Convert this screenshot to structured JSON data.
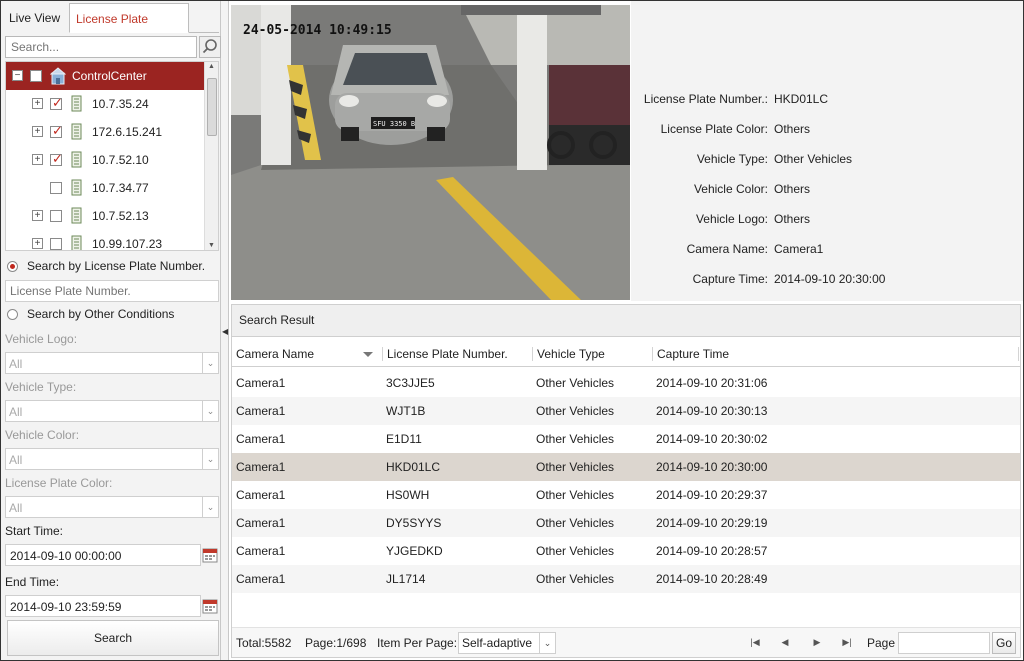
{
  "tabs": [
    {
      "label": "Live View"
    },
    {
      "label": "License Plate Query"
    }
  ],
  "search": {
    "placeholder": "Search..."
  },
  "tree": {
    "root": {
      "label": "ControlCenter"
    },
    "items": [
      {
        "label": "10.7.35.24",
        "checked": true,
        "expandable": true
      },
      {
        "label": "172.6.15.241",
        "checked": true,
        "expandable": true
      },
      {
        "label": "10.7.52.10",
        "checked": true,
        "expandable": true
      },
      {
        "label": "10.7.34.77",
        "checked": false,
        "expandable": false
      },
      {
        "label": "10.7.52.13",
        "checked": false,
        "expandable": true
      },
      {
        "label": "10.99.107.23",
        "checked": false,
        "expandable": true
      }
    ]
  },
  "filters": {
    "by_plate_label": "Search by License Plate Number.",
    "plate_placeholder": "License Plate Number.",
    "by_other_label": "Search by Other Conditions",
    "vehicle_logo_label": "Vehicle Logo:",
    "vehicle_logo_value": "All",
    "vehicle_type_label": "Vehicle Type:",
    "vehicle_type_value": "All",
    "vehicle_color_label": "Vehicle Color:",
    "vehicle_color_value": "All",
    "plate_color_label": "License Plate Color:",
    "plate_color_value": "All",
    "start_time_label": "Start Time:",
    "start_time_value": "2014-09-10 00:00:00",
    "end_time_label": "End Time:",
    "end_time_value": "2014-09-10 23:59:59",
    "search_button": "Search"
  },
  "video": {
    "osd_timestamp": "24-05-2014 10:49:15",
    "plate_on_car": "SFU 3350 B"
  },
  "detail": [
    {
      "key": "License Plate Number.:",
      "value": "HKD01LC"
    },
    {
      "key": "License Plate Color:",
      "value": "Others"
    },
    {
      "key": "Vehicle Type:",
      "value": "Other Vehicles"
    },
    {
      "key": "Vehicle Color:",
      "value": "Others"
    },
    {
      "key": "Vehicle Logo:",
      "value": "Others"
    },
    {
      "key": "Camera Name:",
      "value": "Camera1"
    },
    {
      "key": "Capture Time:",
      "value": "2014-09-10 20:30:00"
    }
  ],
  "result": {
    "title": "Search Result",
    "columns": [
      "Camera Name",
      "License Plate Number.",
      "Vehicle Type",
      "Capture Time"
    ],
    "rows": [
      [
        "Camera1",
        "3C3JJE5",
        "Other Vehicles",
        "2014-09-10 20:31:06"
      ],
      [
        "Camera1",
        "WJT1B",
        "Other Vehicles",
        "2014-09-10 20:30:13"
      ],
      [
        "Camera1",
        "E1D11",
        "Other Vehicles",
        "2014-09-10 20:30:02"
      ],
      [
        "Camera1",
        "HKD01LC",
        "Other Vehicles",
        "2014-09-10 20:30:00"
      ],
      [
        "Camera1",
        "HS0WH",
        "Other Vehicles",
        "2014-09-10 20:29:37"
      ],
      [
        "Camera1",
        "DY5SYYS",
        "Other Vehicles",
        "2014-09-10 20:29:19"
      ],
      [
        "Camera1",
        "YJGEDKD",
        "Other Vehicles",
        "2014-09-10 20:28:57"
      ],
      [
        "Camera1",
        "JL1714",
        "Other Vehicles",
        "2014-09-10 20:28:49"
      ]
    ],
    "selected_row": 3
  },
  "footer": {
    "total": "Total:5582",
    "page": "Page:1/698",
    "items_per_page_label": "Item Per Page:",
    "items_per_page_value": "Self-adaptive",
    "page_label": "Page",
    "go_button": "Go"
  },
  "colors": {
    "accent": "#9b2421",
    "check_red": "#c0281e",
    "selected_row": "#dcd6cf"
  }
}
